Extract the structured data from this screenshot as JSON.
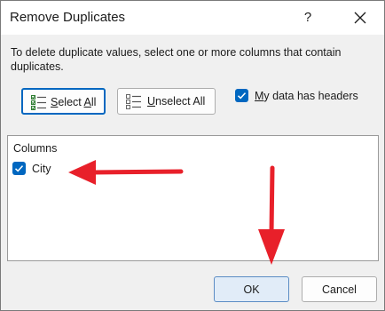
{
  "dialog": {
    "title": "Remove Duplicates",
    "help_symbol": "?",
    "description": "To delete duplicate values, select one or more columns that contain duplicates."
  },
  "toolbar": {
    "select_all": {
      "accel": "S",
      "rest": "elect ",
      "underlined": "A",
      "tail": "ll"
    },
    "unselect_all": {
      "accel": "U",
      "rest": "nselect All"
    },
    "headers_checkbox": {
      "accel": "M",
      "rest": "y data has headers",
      "checked": true
    }
  },
  "columns": {
    "title": "Columns",
    "items": [
      {
        "label": "City",
        "checked": true
      }
    ]
  },
  "footer": {
    "ok_label": "OK",
    "cancel_label": "Cancel"
  },
  "colors": {
    "accent": "#0067c0",
    "annotation_arrow": "#e8202a"
  },
  "icons": [
    "help-icon",
    "close-icon",
    "select-all-icon",
    "unselect-all-icon",
    "checkmark-icon",
    "annotation-arrow"
  ]
}
